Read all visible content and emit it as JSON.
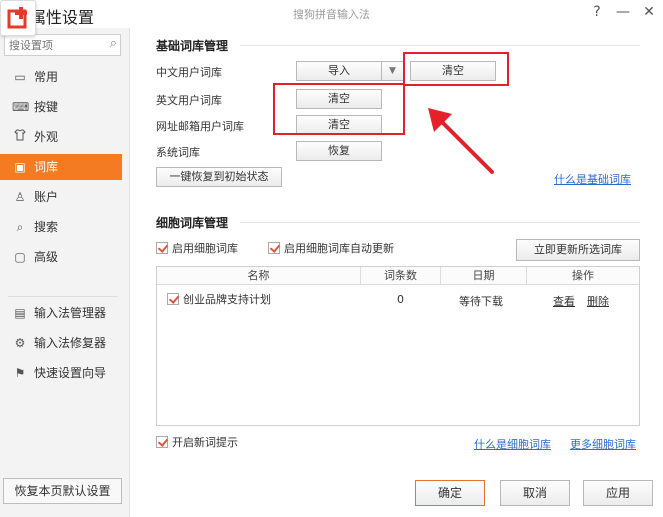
{
  "window": {
    "title": "属性设置",
    "center_title": "搜狗拼音输入法",
    "help": "?",
    "minimize": "—",
    "close": "✕"
  },
  "search": {
    "placeholder": "搜设置项"
  },
  "sidebar": {
    "items": [
      {
        "label": "常用",
        "icon": "monitor-icon",
        "glyph": "▭"
      },
      {
        "label": "按键",
        "icon": "keyboard-icon",
        "glyph": "⌨"
      },
      {
        "label": "外观",
        "icon": "shirt-icon",
        "glyph": "👕"
      },
      {
        "label": "词库",
        "icon": "book-icon",
        "glyph": "▣"
      },
      {
        "label": "账户",
        "icon": "user-icon",
        "glyph": "♙"
      },
      {
        "label": "搜索",
        "icon": "search-icon",
        "glyph": "⌕"
      },
      {
        "label": "高级",
        "icon": "advanced-icon",
        "glyph": "▢"
      },
      {
        "label": "输入法管理器",
        "icon": "manager-icon",
        "glyph": "▤"
      },
      {
        "label": "输入法修复器",
        "icon": "repair-icon",
        "glyph": "⚙"
      },
      {
        "label": "快速设置向导",
        "icon": "flag-icon",
        "glyph": "⚑"
      }
    ],
    "active_index": 3,
    "reset_label": "恢复本页默认设置"
  },
  "basic": {
    "title": "基础词库管理",
    "cn_label": "中文用户词库",
    "import_label": "导入",
    "cn_clear_label": "清空",
    "en_label": "英文用户词库",
    "en_clear_label": "清空",
    "email_label": "网址邮箱用户词库",
    "email_clear_label": "清空",
    "system_label": "系统词库",
    "restore_label": "恢复",
    "one_key_label": "一键恢复到初始状态",
    "what_link": "什么是基础词库"
  },
  "cell": {
    "title": "细胞词库管理",
    "enable_label": "启用细胞词库",
    "auto_update_label": "启用细胞词库自动更新",
    "update_now_label": "立即更新所选词库",
    "columns": [
      "名称",
      "词条数",
      "日期",
      "操作"
    ],
    "row": {
      "name": "创业品牌支持计划",
      "count": "0",
      "date": "等待下载",
      "view": "查看",
      "delete": "删除"
    },
    "new_word_label": "开启新词提示",
    "link1": "什么是细胞词库",
    "link2": "更多细胞词库"
  },
  "footer": {
    "ok": "确定",
    "cancel": "取消",
    "apply": "应用"
  },
  "colors": {
    "accent": "#f47b21",
    "annotation_red": "#e4212b",
    "link": "#2b6dcc"
  }
}
